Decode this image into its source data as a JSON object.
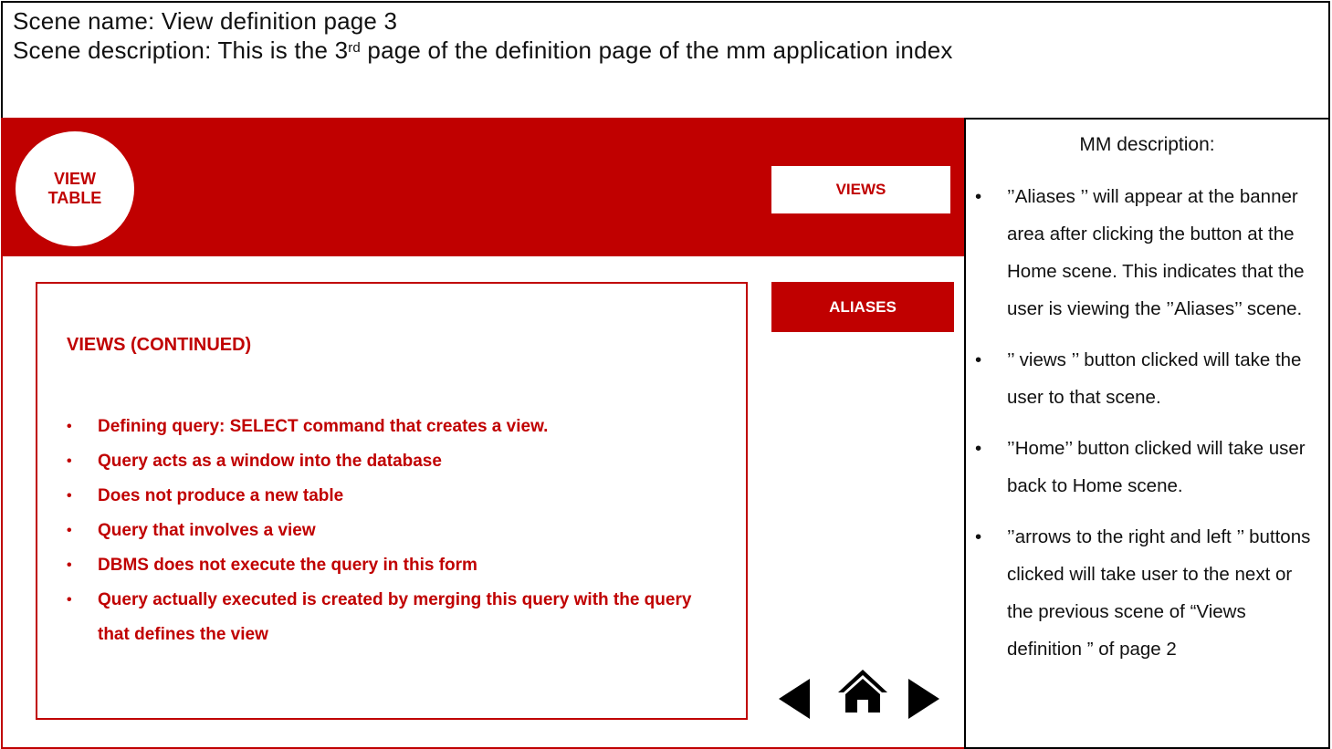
{
  "scene": {
    "name_line": "Scene name: View definition page 3",
    "description_prefix": "Scene description: This is the 3",
    "description_sup": "rd",
    "description_suffix": " page of the definition page of the mm application index"
  },
  "banner": {
    "circle_label": "VIEW\nTABLE",
    "views_button": "VIEWS",
    "aliases_button": "ALIASES"
  },
  "content": {
    "title": "VIEWS (CONTINUED)",
    "bullets": [
      "Defining query: SELECT command that creates a view.",
      "Query acts as a window into the database",
      "Does not produce a new table",
      "Query that involves a view",
      "DBMS does not execute the query in this form",
      "Query actually executed is created by merging this query with the query that defines the view"
    ]
  },
  "nav": {
    "left_icon": "triangle-left-icon",
    "home_icon": "home-icon",
    "right_icon": "triangle-right-icon"
  },
  "mm": {
    "title": "MM description:",
    "items": [
      "’’Aliases ’’ will appear at the banner area after clicking the button at the Home scene. This indicates that the user is viewing the ’’Aliases’’ scene.",
      "’’ views ’’ button clicked will take the user to that scene.",
      "’’Home’’ button clicked will take user back to Home scene.",
      "’’arrows to the right and left ’’ buttons clicked will take user to the next or the previous scene of “Views definition ” of page 2"
    ]
  },
  "colors": {
    "accent": "#c00000",
    "text": "#111111"
  }
}
